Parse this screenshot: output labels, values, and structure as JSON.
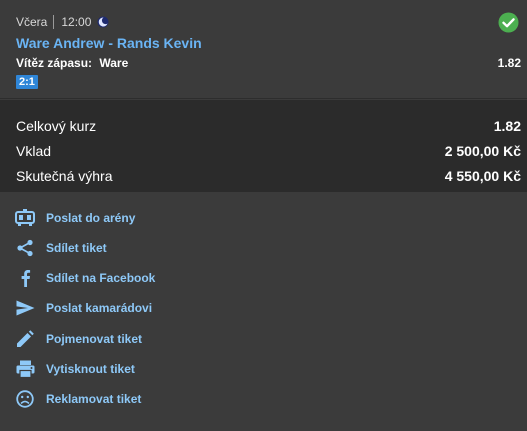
{
  "bet": {
    "day": "Včera",
    "time": "12:00",
    "sport_icon": "moon-icon",
    "status_icon": "check-circle-icon",
    "match": "Ware Andrew - Rands Kevin",
    "market_label": "Vítěz zápasu:",
    "selection": "Ware",
    "odds": "1.82",
    "score": "2:1"
  },
  "summary": {
    "total_odds_label": "Celkový kurz",
    "total_odds_value": "1.82",
    "stake_label": "Vklad",
    "stake_value": "2 500,00 Kč",
    "payout_label": "Skutečná výhra",
    "payout_value": "4 550,00 Kč"
  },
  "actions": [
    {
      "label": "Poslat do arény",
      "icon": "arena-icon"
    },
    {
      "label": "Sdílet tiket",
      "icon": "share-icon"
    },
    {
      "label": "Sdílet na Facebook",
      "icon": "facebook-icon"
    },
    {
      "label": "Poslat kamarádovi",
      "icon": "send-icon"
    },
    {
      "label": "Pojmenovat tiket",
      "icon": "pencil-icon"
    },
    {
      "label": "Vytisknout tiket",
      "icon": "print-icon"
    },
    {
      "label": "Reklamovat tiket",
      "icon": "sad-face-icon"
    }
  ],
  "colors": {
    "background": "#3b3b3b",
    "summary_background": "#2b2b2b",
    "link": "#8ec9f8",
    "match_title": "#6ab4f4",
    "badge": "#2f86d8",
    "success": "#4caf50"
  }
}
